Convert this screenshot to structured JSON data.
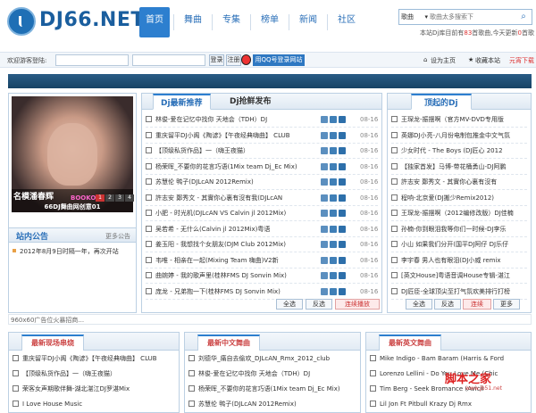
{
  "header": {
    "logo_text": "DJ66.NET",
    "nav": [
      "首页",
      "舞曲",
      "专集",
      "榜单",
      "新闻",
      "社区"
    ],
    "search_select": "歌曲",
    "search_placeholder": "歌曲太多搜索下",
    "search_icon": "search-icon",
    "stat_pre": "本站Dj库目前有",
    "stat_count": "83",
    "stat_mid": "首歌曲,今天更新",
    "stat_today": "0",
    "stat_post": "首歌"
  },
  "login": {
    "label": "欢迎游客登陆:",
    "btn_login": "登录",
    "btn_register": "注册",
    "qq_label": "用QQ号登录网站",
    "set_home": "设为主页",
    "bookmark": "收藏本站",
    "red_text": "元宵下载"
  },
  "left_panel": {
    "caption_text": "名模潘春辉",
    "caption_counter": "BOOKO",
    "pages": [
      "1",
      "2",
      "3",
      "4"
    ],
    "album_title": "66DJ舞曲网创意01",
    "notice_title": "站内公告",
    "notice_more": "更多公告",
    "notice_items": [
      "2012年8月9日时隔一年，再次开站"
    ]
  },
  "center_panel": {
    "tabs": [
      "Dj最新推荐",
      "Dj抢鲜发布"
    ],
    "rows": [
      {
        "title": "林俊-爱在记忆中找你  天地会（TDH）DJ",
        "date": "08-16"
      },
      {
        "title": "重庆留平DJ小阁《陶谚》【午夜经典嗨曲】 CLUB",
        "date": "08-16"
      },
      {
        "title": "【顶级私货作品】一（嗨王夜猫）",
        "date": "08-16"
      },
      {
        "title": "杨荣晖_不要你的花言巧语(1Mix team Dj_Ec Mix)",
        "date": "08-16"
      },
      {
        "title": "苏慧伦 鸭子(DJLcAN 2012Remix)",
        "date": "08-16"
      },
      {
        "title": "許志安 鄭秀文 - 其實你心裏有沒有我(DJLcAN",
        "date": "08-16"
      },
      {
        "title": "小肥 - 时光机(DJLcAN VS Calvin jl 2012Mix)",
        "date": "08-16"
      },
      {
        "title": "吴若希 - 无什么(Calvin jl 2012Mix)粤语",
        "date": "08-16"
      },
      {
        "title": "姜玉阳 - 我想找个女朋友(DJM Club 2012Mix)",
        "date": "08-16"
      },
      {
        "title": "韦唯 - 相亲在一起(Mixing Team 嗨曲)V2新",
        "date": "08-16"
      },
      {
        "title": "曲婉婷 - 我的歌声里(桂林FMS DJ Sonvin Mix)",
        "date": "08-16"
      },
      {
        "title": "庞龙 - 兄弟抱一下(桂林FMS DJ Sonvin Mix)",
        "date": "08-16"
      }
    ],
    "btn_all": "全选",
    "btn_invert": "反选",
    "btn_play": "连续播放"
  },
  "right_panel": {
    "title": "顶起的Dj",
    "rows": [
      "王琛龙-振摆啊（官方MV-DVD专用版",
      "英娜DJ小亮-八月份电制包推金中文气氛",
      "少女时代 - The Boys (DJ匠心 2012",
      "【独家首发】马博-带花桶勇山-DJ阿鹏",
      "許志安 鄭秀文 - 其實你心裏有沒有",
      "程响-北京爱(DJ搬少Remix2012)",
      "王琛龙-振摆啊（2012编修改版）DJ佳楠",
      "孙楠-你到眼泪我等你们一时候-DJ李乐",
      "小山 如果我们分开(国平DJ阿仔 DJ乐仔",
      "李宇春 男人也有眼泪(DJ小威 remix",
      "[英文House]粤语音调House专辑-湛江",
      "DJ匠臣-全球顶尖至打气氛欢美排行打榜"
    ],
    "btn_all": "全选",
    "btn_invert": "反选",
    "btn_play": "连续",
    "btn_more": "更多"
  },
  "ad_text": "960x60广告位火暴招商...",
  "sections": [
    {
      "title": "最新现场串烧",
      "rows": [
        "重庆留平DJ小阁《陶谚》【午夜经典嗨曲】 CLUB",
        "【顶级私货作品】一（嗨王夜猫）",
        "荣客女声期歌伴舞-湖北湛江DJ罗湛Mix",
        "I Love House Music"
      ]
    },
    {
      "title": "最新中文舞曲",
      "rows": [
        "刘德华_痛自去偷欢_DJLcAN_Rmx_2012_club",
        "林俊-爱在记忆中找你 天地会（TDH）DJ",
        "杨荣晖_不要你的花言巧语(1Mix team Dj_Ec Mix)",
        "苏慧伦 鸭子(DJLcAN 2012Remix)"
      ]
    },
    {
      "title": "最新英文舞曲",
      "rows": [
        "Mike Indigo - Bam Baram (Harris & Ford",
        "Lorenzo Lellini - Do You Love Me (Chic",
        "Tim Berg - Seek Bromance (Avicii",
        "Lil Jon Ft Pitbull Krazy Dj Rmx"
      ]
    }
  ],
  "watermark": "脚本之家",
  "watermark_sub": "www.jb51.net"
}
